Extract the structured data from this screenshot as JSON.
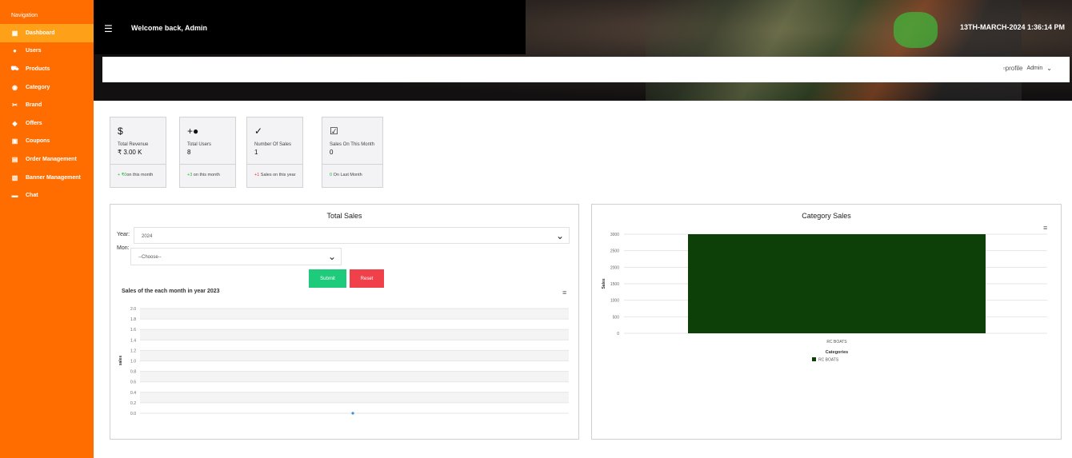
{
  "sidebar": {
    "title": "Navigation",
    "items": [
      {
        "label": "Dashboard",
        "icon": "grid-icon",
        "glyph": "▦"
      },
      {
        "label": "Users",
        "icon": "user-icon",
        "glyph": "●"
      },
      {
        "label": "Products",
        "icon": "cart-icon",
        "glyph": "⛟"
      },
      {
        "label": "Category",
        "icon": "category-icon",
        "glyph": "◉"
      },
      {
        "label": "Brand",
        "icon": "brand-icon",
        "glyph": "✂"
      },
      {
        "label": "Offers",
        "icon": "tag-icon",
        "glyph": "◆"
      },
      {
        "label": "Coupons",
        "icon": "coupon-icon",
        "glyph": "▣"
      },
      {
        "label": "Order Management",
        "icon": "order-icon",
        "glyph": "▤"
      },
      {
        "label": "Banner Management",
        "icon": "banner-icon",
        "glyph": "▧"
      },
      {
        "label": "Chat",
        "icon": "chat-icon",
        "glyph": "▬"
      }
    ]
  },
  "header": {
    "welcome": "Welcome back,  Admin",
    "datetime": "13TH-MARCH-2024 1:36:14 PM",
    "profile_alt": "profile",
    "profile_name": "Admin"
  },
  "cards": [
    {
      "label": "Total Revenue",
      "value": "₹ 3.00 K",
      "foot_hl": "+ ₹0",
      "foot": "on this month",
      "foot_color": "green",
      "icon": "dollar-icon",
      "glyph": "$"
    },
    {
      "label": "Total Users",
      "value": "8",
      "foot_hl": "+3",
      "foot": " on this month",
      "foot_color": "green",
      "icon": "user-plus-icon",
      "glyph": "+●"
    },
    {
      "label": "Number Of Sales",
      "value": "1",
      "foot_hl": "+1",
      "foot": " Sales on this year",
      "foot_color": "red",
      "icon": "check-circle-icon",
      "glyph": "✓"
    },
    {
      "label": "Sales On This Month",
      "value": "0",
      "foot_hl": "0",
      "foot": " On Last Month",
      "foot_color": "green",
      "icon": "check-square-icon",
      "glyph": "☑"
    }
  ],
  "total_sales": {
    "title": "Total Sales",
    "year_label": "Year:",
    "year_value": "2024",
    "month_label": "Mon:",
    "month_placeholder": "--Choose--",
    "submit": "Submit",
    "reset": "Reset",
    "submit_color": "#1ecb7a",
    "reset_color": "#f0404a"
  },
  "category_sales": {
    "title": "Category Sales"
  },
  "chart_data": [
    {
      "type": "line",
      "title": "Sales of the each month in year 2023",
      "ylabel": "sales",
      "xlabel": "",
      "ylim": [
        0,
        2
      ],
      "yticks": [
        "2.0",
        "1.8",
        "1.6",
        "1.4",
        "1.2",
        "1.0",
        "0.8",
        "0.6",
        "0.4",
        "0.2",
        "0.0"
      ],
      "x": [
        1
      ],
      "series": [
        {
          "values": [
            0
          ],
          "color": "#3a8fd6"
        }
      ],
      "grid": true
    },
    {
      "type": "bar",
      "title": "",
      "xlabel": "Categories",
      "ylabel": "Sales",
      "categories": [
        "RC BOATS"
      ],
      "series": [
        {
          "name": "RC BOATS",
          "values": [
            3000
          ],
          "color": "#0d3f09"
        }
      ],
      "ylim": [
        0,
        3000
      ],
      "yticks": [
        "3000",
        "2500",
        "2000",
        "1500",
        "1000",
        "500",
        "0"
      ],
      "legend": "bottom",
      "grid": true
    }
  ]
}
